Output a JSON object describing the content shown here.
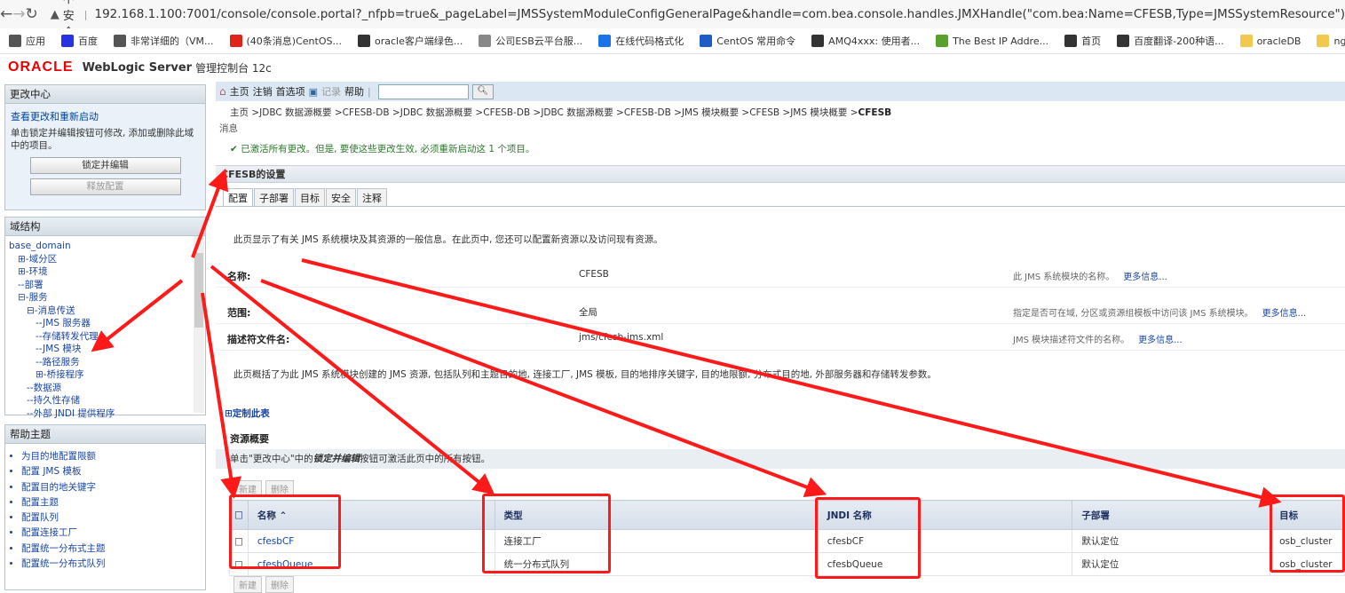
{
  "browser": {
    "security_label": "不安全",
    "url": "192.168.1.100:7001/console/console.portal?_nfpb=true&_pageLabel=JMSSystemModuleConfigGeneralPage&handle=com.bea.console.handles.JMXHandle(\"com.bea:Name=CFESB,Type=JMSSystemResource\")",
    "bookmarks": [
      {
        "label": "应用",
        "icon": "apps-icon",
        "color": "#555555"
      },
      {
        "label": "百度",
        "icon": "baidu-icon",
        "color": "#2932e1"
      },
      {
        "label": "非常详细的（VM...",
        "icon": "csdn-icon",
        "color": "#555555"
      },
      {
        "label": "(40条消息)CentOS...",
        "icon": "csdn-c-icon",
        "color": "#e2231a"
      },
      {
        "label": "oracle客户端绿色...",
        "icon": "globe-icon",
        "color": "#333333"
      },
      {
        "label": "公司ESB云平台服...",
        "icon": "image-icon",
        "color": "#888888"
      },
      {
        "label": "在线代码格式化",
        "icon": "c-icon",
        "color": "#1a73e8"
      },
      {
        "label": "CentOS 常用命令",
        "icon": "tk-icon",
        "color": "#1e5bc6"
      },
      {
        "label": "AMQ4xxx: 使用者...",
        "icon": "ibm-icon",
        "color": "#333333"
      },
      {
        "label": "The Best IP Addre...",
        "icon": "ip-icon",
        "color": "#5aa02c"
      },
      {
        "label": "首页",
        "icon": "globe-icon",
        "color": "#333333"
      },
      {
        "label": "百度翻译-200种语...",
        "icon": "globe-icon",
        "color": "#333333"
      },
      {
        "label": "oracleDB",
        "icon": "folder-icon",
        "color": "#f2c94c"
      },
      {
        "label": "nginx",
        "icon": "folder-icon",
        "color": "#f2c94c"
      }
    ]
  },
  "header": {
    "logo": "ORACLE",
    "product": "WebLogic Server",
    "subtitle": "管理控制台 12c"
  },
  "change_center": {
    "title": "更改中心",
    "link": "查看更改和重新启动",
    "text": "单击锁定并编辑按钮可修改, 添加或删除此域中的项目。",
    "lock_button": "锁定并编辑",
    "release_button": "释放配置"
  },
  "domain_tree": {
    "title": "域结构",
    "nodes": [
      "base_domain",
      "⊞-域分区",
      "⊞-环境",
      "--部署",
      "⊟-服务",
      "⊟-消息传送",
      "--JMS 服务器",
      "--存储转发代理",
      "--JMS 模块",
      "--路径服务",
      "⊞-桥接程序",
      "--数据源",
      "--持久性存储",
      "--外部 JNDI 提供程序"
    ]
  },
  "help": {
    "title": "帮助主题",
    "items": [
      "为目的地配置限额",
      "配置 JMS 模板",
      "配置目的地关键字",
      "配置主题",
      "配置队列",
      "配置连接工厂",
      "配置统一分布式主题",
      "配置统一分布式队列"
    ]
  },
  "toolbar": {
    "home": "主页",
    "logout": "注销",
    "prefs": "首选项",
    "record": "记录",
    "help": "帮助"
  },
  "breadcrumb": "主页 >JDBC 数据源概要 >CFESB-DB >JDBC 数据源概要 >CFESB-DB >JDBC 数据源概要 >CFESB-DB >JMS 模块概要 >CFESB >JMS 模块概要 >",
  "breadcrumb_current": "CFESB",
  "messages_label": "消息",
  "message": "✔ 已激活所有更改。但是, 要使这些更改生效, 必须重新启动这 1 个项目。",
  "settings_title": "CFESB的设置",
  "tabs": [
    "配置",
    "子部署",
    "目标",
    "安全",
    "注释"
  ],
  "intro": "此页显示了有关 JMS 系统模块及其资源的一般信息。在此页中, 您还可以配置新资源以及访问现有资源。",
  "fields": [
    {
      "label": "名称:",
      "value": "CFESB",
      "desc": "此 JMS 系统模块的名称。",
      "more": "更多信息..."
    },
    {
      "label": "范围:",
      "value": "全局",
      "desc": "指定是否可在域, 分区或资源组模板中访问该 JMS 系统模块。",
      "more": "更多信息..."
    },
    {
      "label": "描述符文件名:",
      "value": "jms/cfesb-jms.xml",
      "desc": "JMS 模块描述符文件的名称。",
      "more": "更多信息..."
    }
  ],
  "summary_para": "此页概括了为此 JMS 系统模块创建的 JMS 资源, 包括队列和主题目的地, 连接工厂, JMS 模板, 目的地排序关键字, 目的地限额, 分布式目的地, 外部服务器和存储转发参数。",
  "customize_link": "定制此表",
  "resources_title": "资源概要",
  "note": {
    "pre": "单击\"更改中心\"中的",
    "em": "锁定并编辑",
    "post": "按钮可激活此页中的所有按钮。"
  },
  "buttons": {
    "new": "新建",
    "delete": "删除"
  },
  "table": {
    "headers": [
      "名称 ⌃",
      "类型",
      "JNDI 名称",
      "子部署",
      "目标"
    ],
    "rows": [
      [
        "cfesbCF",
        "连接工厂",
        "cfesbCF",
        "默认定位",
        "osb_cluster"
      ],
      [
        "cfesbQueue",
        "统一分布式队列",
        "cfesbQueue",
        "默认定位",
        "osb_cluster"
      ]
    ]
  },
  "annotation_color": "#ff1a1a"
}
